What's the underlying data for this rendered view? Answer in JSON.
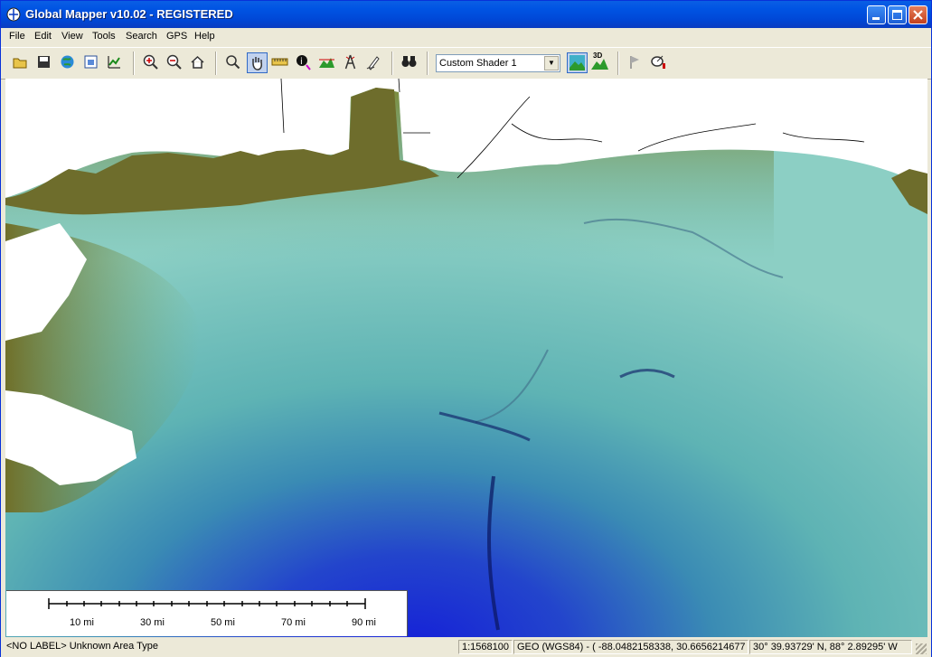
{
  "window": {
    "title": "Global Mapper v10.02 - REGISTERED"
  },
  "menu": {
    "items": [
      "File",
      "Edit",
      "View",
      "Tools",
      "Search",
      "GPS",
      "Help"
    ]
  },
  "toolbar": {
    "shader_value": "Custom Shader 1",
    "view_3d_label": "3D",
    "icons": [
      "open-folder-icon",
      "save-icon",
      "globe-icon",
      "export-icon",
      "chart-icon",
      "zoom-in-icon",
      "zoom-out-icon",
      "home-icon",
      "zoom-tool-icon",
      "pan-hand-icon",
      "ruler-icon",
      "info-icon",
      "terrain-profile-icon",
      "tower-icon",
      "digitizer-icon",
      "binoculars-icon",
      "shaded-relief-icon",
      "view-3d-icon",
      "flag-icon",
      "gps-icon"
    ]
  },
  "scale": {
    "labels": [
      "10 mi",
      "30 mi",
      "50 mi",
      "70 mi",
      "90 mi"
    ]
  },
  "status": {
    "feature": "<NO LABEL> Unknown Area Type",
    "scale": "1:1568100",
    "projection": "GEO (WGS84) - ( -88.0482158338, 30.6656214677 )",
    "dms": "30° 39.93729' N, 88° 2.89295' W"
  },
  "colors": {
    "titlebar": "#0054e3",
    "land": "#6e6d2c",
    "shelf": "#8fc9c2",
    "deep": "#1a2fd0"
  }
}
